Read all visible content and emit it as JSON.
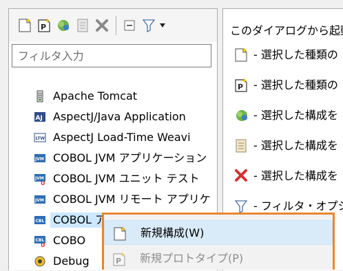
{
  "toolbar": {
    "icons": [
      "new-configuration-icon",
      "new-prototype-icon",
      "duplicate-icon",
      "delete-icon",
      "delete-x-icon",
      "collapse-all-icon",
      "filter-icon",
      "view-menu-icon"
    ]
  },
  "filter": {
    "placeholder": "フィルタ入力"
  },
  "tree": {
    "items": [
      {
        "label": "Apache Tomcat",
        "icon": "tomcat-icon"
      },
      {
        "label": "AspectJ/Java Application",
        "icon": "aspectj-icon"
      },
      {
        "label": "AspectJ Load-Time Weavi",
        "icon": "ltw-icon"
      },
      {
        "label": "COBOL JVM アプリケーション",
        "icon": "jvm-icon"
      },
      {
        "label": "COBOL JVM ユニット テスト",
        "icon": "jvm-unit-icon"
      },
      {
        "label": "COBOL JVM リモート アプリケ",
        "icon": "jvm-remote-icon"
      },
      {
        "label": "COBOL アプリケーション",
        "icon": "cbl-icon",
        "selected": true
      },
      {
        "label": "COBO",
        "icon": "cbl-unit-icon"
      },
      {
        "label": "Debug",
        "icon": "debug-icon"
      }
    ]
  },
  "description": {
    "heading": "このダイアログから起動",
    "lines": [
      {
        "text": "- 選択した種類の",
        "icon": "new-configuration-icon"
      },
      {
        "text": "- 選択した種類の",
        "icon": "new-prototype-icon"
      },
      {
        "text": "- 選択した構成を",
        "icon": "duplicate-icon"
      },
      {
        "text": "- 選択した構成を",
        "icon": "export-icon"
      },
      {
        "text": "- 選択した構成を",
        "icon": "delete-x-icon"
      },
      {
        "text": "- フィルタ・オプション",
        "icon": "filter-icon"
      }
    ]
  },
  "context_menu": {
    "items": [
      {
        "label": "新規構成(W)",
        "enabled": true,
        "highlighted": true,
        "icon": "new-configuration-icon"
      },
      {
        "label": "新規プロトタイプ(P)",
        "enabled": false,
        "icon": "new-prototype-icon"
      }
    ]
  },
  "colors": {
    "selection": "#cce8ff",
    "menu_border": "#e8862e",
    "menu_highlight": "#d9ebf9"
  }
}
